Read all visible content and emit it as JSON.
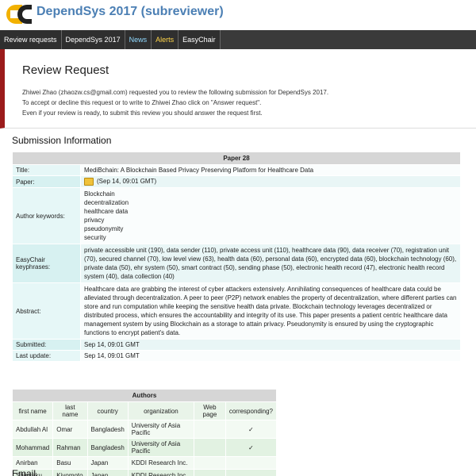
{
  "header": {
    "title": "DependSys 2017 (subreviewer)"
  },
  "nav": {
    "items": [
      "Review requests",
      "DependSys 2017",
      "News",
      "Alerts",
      "EasyChair"
    ]
  },
  "review": {
    "heading": "Review Request",
    "line1": "Zhiwei Zhao (zhaozw.cs@gmail.com) requested you to review the following submission for DependSys 2017.",
    "line2": "To accept or decline this request or to write to Zhiwei Zhao click on \"Answer request\".",
    "line3": "Even if your review is ready, to submit this review you should answer the request first."
  },
  "submission": {
    "section_title": "Submission Information",
    "paper_label": "Paper 28",
    "title_label": "Title:",
    "title": "MediBchain: A Blockchain Based Privacy Preserving Platform for Healthcare Data",
    "paper_field_label": "Paper:",
    "paper_date": "(Sep 14, 09:01 GMT)",
    "keywords_label": "Author keywords:",
    "keywords": [
      "Blockchain",
      "decentralization",
      "healthcare data",
      "privacy",
      "pseudonymity",
      "security"
    ],
    "keyphrases_label": "EasyChair keyphrases:",
    "keyphrases": "private accessible unit (190), data sender (110), private access unit (110), healthcare data (90), data receiver (70), registration unit (70), secured channel (70), low level view (63), health data (60), personal data (60), encrypted data (60), blockchain technology (60), private data (50), ehr system (50), smart contract (50), sending phase (50), electronic health record (47), electronic health record system (40), data collection (40)",
    "abstract_label": "Abstract:",
    "abstract": "Healthcare data are grabbing the interest of cyber attackers extensively. Annihilating consequences of healthcare data could be alleviated through decentralization. A peer to peer (P2P) network enables the property of decentralization, where different parties can store and run computation while keeping the sensitive health data private. Blockchain technology leverages decentralized or distributed process, which ensures the accountability and integrity of its use. This paper presents a patient centric healthcare data management system by using Blockchain as a storage to attain privacy. Pseudonymity is ensured by using the cryptographic functions to encrypt patient's data.",
    "submitted_label": "Submitted:",
    "submitted": "Sep 14, 09:01 GMT",
    "lastupdate_label": "Last update:",
    "lastupdate": "Sep 14, 09:01 GMT"
  },
  "authors": {
    "caption": "Authors",
    "headers": [
      "first name",
      "last name",
      "country",
      "organization",
      "Web page",
      "corresponding?"
    ],
    "rows": [
      [
        "Abdullah Al",
        "Omar",
        "Bangladesh",
        "University of Asia Pacific",
        "",
        "✓"
      ],
      [
        "Mohammad",
        "Rahman",
        "Bangladesh",
        "University of Asia Pacific",
        "",
        "✓"
      ],
      [
        "Anirban",
        "Basu",
        "Japan",
        "KDDI Research Inc.",
        "",
        ""
      ],
      [
        "Shinsaku",
        "Kiyomoto",
        "Japan",
        "KDDI Research Inc.",
        "",
        ""
      ]
    ]
  },
  "next_section": "Email"
}
